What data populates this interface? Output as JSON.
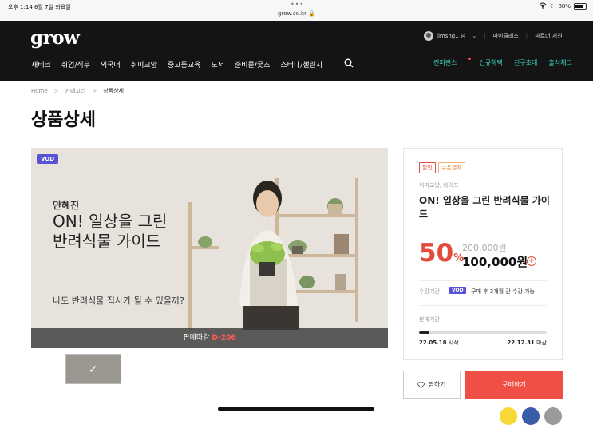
{
  "status_bar": {
    "time_date": "오후 1:14   6월 7일 화요일",
    "dots": "•••",
    "url": "grow.co.kr",
    "battery": "88%",
    "battery_level": 0.88
  },
  "header": {
    "logo": "grow",
    "user": "jimsng.. 님",
    "my_class": "마이클래스",
    "partner": "파트너 지원",
    "nav": [
      "재테크",
      "취업/직무",
      "외국어",
      "취미교양",
      "중고등교육",
      "도서",
      "준비물/굿즈",
      "스터디/챌린지"
    ],
    "nav_right": [
      "컨퍼런스",
      "신규혜택",
      "친구초대",
      "출석체크"
    ]
  },
  "breadcrumb": [
    "Home",
    "카테고리",
    "상품상세"
  ],
  "page_title": "상품상세",
  "hero": {
    "badge": "VOD",
    "author": "안혜진",
    "title_line1": "ON! 일상을 그린",
    "title_line2": "반려식물 가이드",
    "subtitle": "나도 반려식물 집사가 될 수 있을까?",
    "deadline_label": "판매마감",
    "deadline_value": "D-206"
  },
  "product": {
    "tags": [
      "할인",
      "쿠폰결제"
    ],
    "category": "취미교양, 라이프",
    "title": "ON! 일상을 그린 반려식물 가이드",
    "discount": "50",
    "discount_unit": "%",
    "original_price": "200,000원",
    "price": "100,000원",
    "period_label": "수강기간",
    "period_badge": "VOD",
    "period_text": "구매 후 3개월 간 수강 가능",
    "sale_label": "판매기간",
    "sale_progress": 0.08,
    "start_date": "22.05.18",
    "start_suffix": "시작",
    "end_date": "22.12.31",
    "end_suffix": "마감"
  },
  "actions": {
    "wish": "찜하기",
    "buy": "구매하기"
  },
  "colors": {
    "accent": "#ef4f45",
    "nav_highlight": "#3dd8c3",
    "vod": "#5a52d5",
    "header_bg": "#141414"
  }
}
